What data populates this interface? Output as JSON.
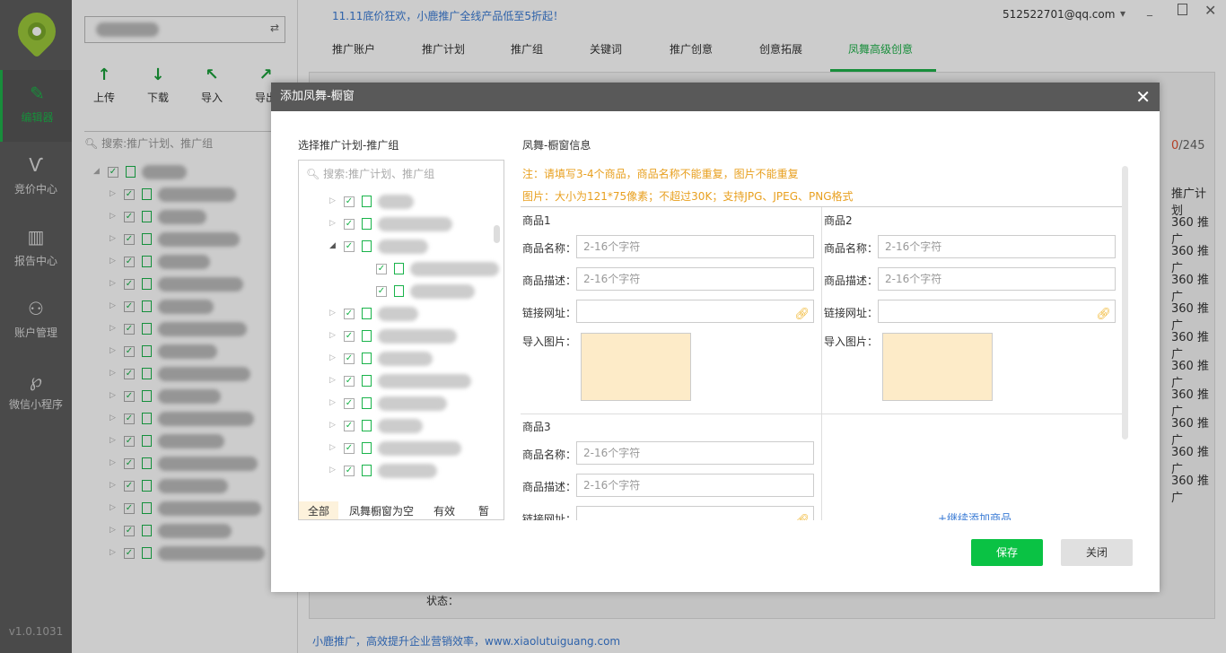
{
  "sidebar": {
    "items": [
      {
        "label": "编辑器",
        "icon": "edit-icon",
        "active": true
      },
      {
        "label": "竞价中心",
        "icon": "antler-icon"
      },
      {
        "label": "报告中心",
        "icon": "bar-chart-icon"
      },
      {
        "label": "账户管理",
        "icon": "user-list-icon"
      },
      {
        "label": "微信小程序",
        "icon": "mini-program-icon"
      }
    ],
    "version": "v1.0.1031"
  },
  "panel": {
    "toolbar": [
      {
        "label": "上传",
        "icon": "upload-icon"
      },
      {
        "label": "下载",
        "icon": "download-icon"
      },
      {
        "label": "导入",
        "icon": "import-icon"
      },
      {
        "label": "导出",
        "icon": "export-icon"
      }
    ],
    "search_placeholder": "搜索:推广计划、推广组"
  },
  "header": {
    "promo": "11.11底价狂欢，小鹿推广全线产品低至5折起！",
    "email": "512522701@qq.com",
    "tabs": [
      "推广账户",
      "推广计划",
      "推广组",
      "关键词",
      "推广创意",
      "创意拓展",
      "凤舞高级创意"
    ],
    "active_tab": "凤舞高级创意"
  },
  "main": {
    "count_selected": "0",
    "count_total": "/245",
    "column_header": "推广计划",
    "cell_value": "360 推广",
    "status_label": "状态：",
    "footer": "小鹿推广，高效提升企业营销效率，www.xiaolutuiguang.com"
  },
  "dialog": {
    "title": "添加凤舞-橱窗",
    "left_title": "选择推广计划-推广组",
    "tree_search_placeholder": "搜索:推广计划、推广组",
    "filters": [
      "全部",
      "凤舞橱窗为空",
      "有效",
      "暂停"
    ],
    "active_filter": "全部",
    "right_title": "凤舞-橱窗信息",
    "note1": "注：请填写3-4个商品，商品名称不能重复，图片不能重复",
    "note2": "图片：大小为121*75像素；不超过30K；支持JPG、JPEG、PNG格式",
    "products": [
      {
        "title": "商品1"
      },
      {
        "title": "商品2"
      },
      {
        "title": "商品3"
      }
    ],
    "labels": {
      "name": "商品名称：",
      "desc": "商品描述：",
      "url": "链接网址：",
      "image": "导入图片："
    },
    "placeholder": "2-16个字符",
    "add_more": "+继续添加商品",
    "save": "保存",
    "close": "关闭"
  },
  "colors": {
    "accent": "#1fb24a",
    "save": "#0ac244",
    "note": "#e8a020",
    "link": "#3a7bd5"
  }
}
